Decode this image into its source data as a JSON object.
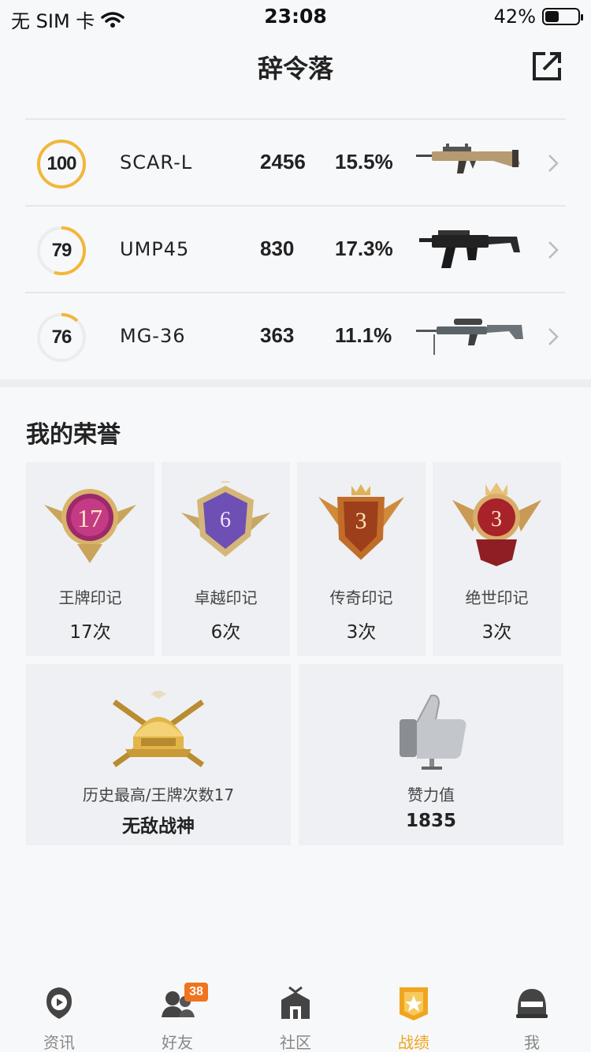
{
  "status_bar": {
    "carrier": "无 SIM 卡",
    "time": "23:08",
    "battery": "42%",
    "battery_level": 0.42
  },
  "header": {
    "title": "辞令落"
  },
  "weapons": [
    {
      "score": "100",
      "score_fraction": 1.0,
      "name": "SCAR-L",
      "kills": "2456",
      "rate": "15.5%"
    },
    {
      "score": "79",
      "score_fraction": 0.55,
      "name": "UMP45",
      "kills": "830",
      "rate": "17.3%"
    },
    {
      "score": "76",
      "score_fraction": 0.12,
      "name": "MG-36",
      "kills": "363",
      "rate": "11.1%"
    }
  ],
  "honors": {
    "title": "我的荣誉",
    "badges": [
      {
        "label": "王牌印记",
        "count": "17次",
        "number": "17"
      },
      {
        "label": "卓越印记",
        "count": "6次",
        "number": "6"
      },
      {
        "label": "传奇印记",
        "count": "3次",
        "number": "3"
      },
      {
        "label": "绝世印记",
        "count": "3次",
        "number": "3"
      }
    ],
    "highest": {
      "label": "历史最高/王牌次数17",
      "value": "无敌战神"
    },
    "likes": {
      "label": "赞力值",
      "value": "1835"
    }
  },
  "tabs": [
    {
      "label": "资讯"
    },
    {
      "label": "好友",
      "badge": "38"
    },
    {
      "label": "社区"
    },
    {
      "label": "战绩"
    },
    {
      "label": "我"
    }
  ],
  "colors": {
    "accent": "#f0a520",
    "ring_gold": "#f2b73a",
    "badge_orange": "#f0731e"
  }
}
